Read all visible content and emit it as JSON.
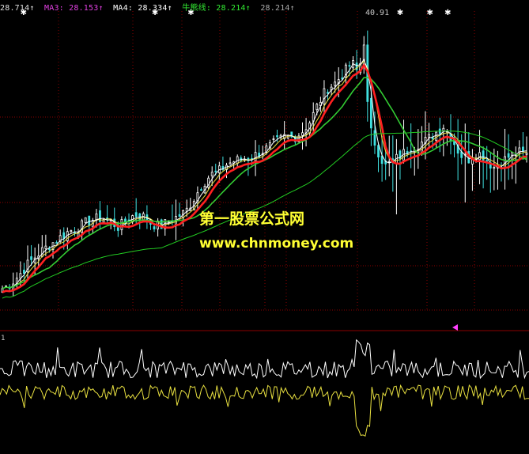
{
  "legend": [
    {
      "text": "28.714↑",
      "color": "#e0e0e0"
    },
    {
      "text": "MA3: 28.153↑",
      "color": "#e040e0"
    },
    {
      "text": "MA4: 28.334↑",
      "color": "#ffffff"
    },
    {
      "text": "牛熊线: 28.214↑",
      "color": "#33ee33"
    },
    {
      "text": "28.214↑",
      "color": "#aaaaaa"
    }
  ],
  "peak_label": "40.91",
  "watermark": {
    "line1": "第一股票公式网",
    "line2": "www.chnmoney.com"
  },
  "indicator_label": "1",
  "colors": {
    "background": "#000000",
    "grid": "#8b0000",
    "candle_up": "#ffffff",
    "candle_down": "#40e0e0",
    "ma_red": "#ff2020",
    "ma_white": "#ffffff",
    "ma_yellow": "#e8e040",
    "ma_green": "#33cc33",
    "long_green": "#22cc22",
    "osc_white": "#ffffff",
    "osc_yellow": "#e8e040",
    "marker": "#ff40ff",
    "stars": "#ffffff"
  },
  "chart_data": {
    "type": "candlestick",
    "ylim": [
      18,
      43
    ],
    "peak_value": 40.91,
    "stars_x_index": [
      3,
      25,
      31,
      66,
      71,
      74,
      99,
      104,
      115,
      116,
      117,
      128,
      134
    ],
    "price_path": [
      19.8,
      20.2,
      20.9,
      21.8,
      22.5,
      23.1,
      23.6,
      24.1,
      24.6,
      24.8,
      25.3,
      25.6,
      25.7,
      25.4,
      24.9,
      25.6,
      26.0,
      25.8,
      25.2,
      25.0,
      25.4,
      25.8,
      26.2,
      27.3,
      28.5,
      29.3,
      29.6,
      30.2,
      30.5,
      30.6,
      30.8,
      31.2,
      31.6,
      32.1,
      32.5,
      32.4,
      32.9,
      33.8,
      35.3,
      36.5,
      37.0,
      37.8,
      38.7,
      37.5,
      33.5,
      31.5,
      30.0,
      30.5,
      31.0,
      31.6,
      31.9,
      32.2,
      32.8,
      33.4,
      32.4,
      31.0,
      30.6,
      31.2,
      30.8,
      29.9,
      30.4,
      30.9,
      31.2,
      31.0
    ]
  }
}
